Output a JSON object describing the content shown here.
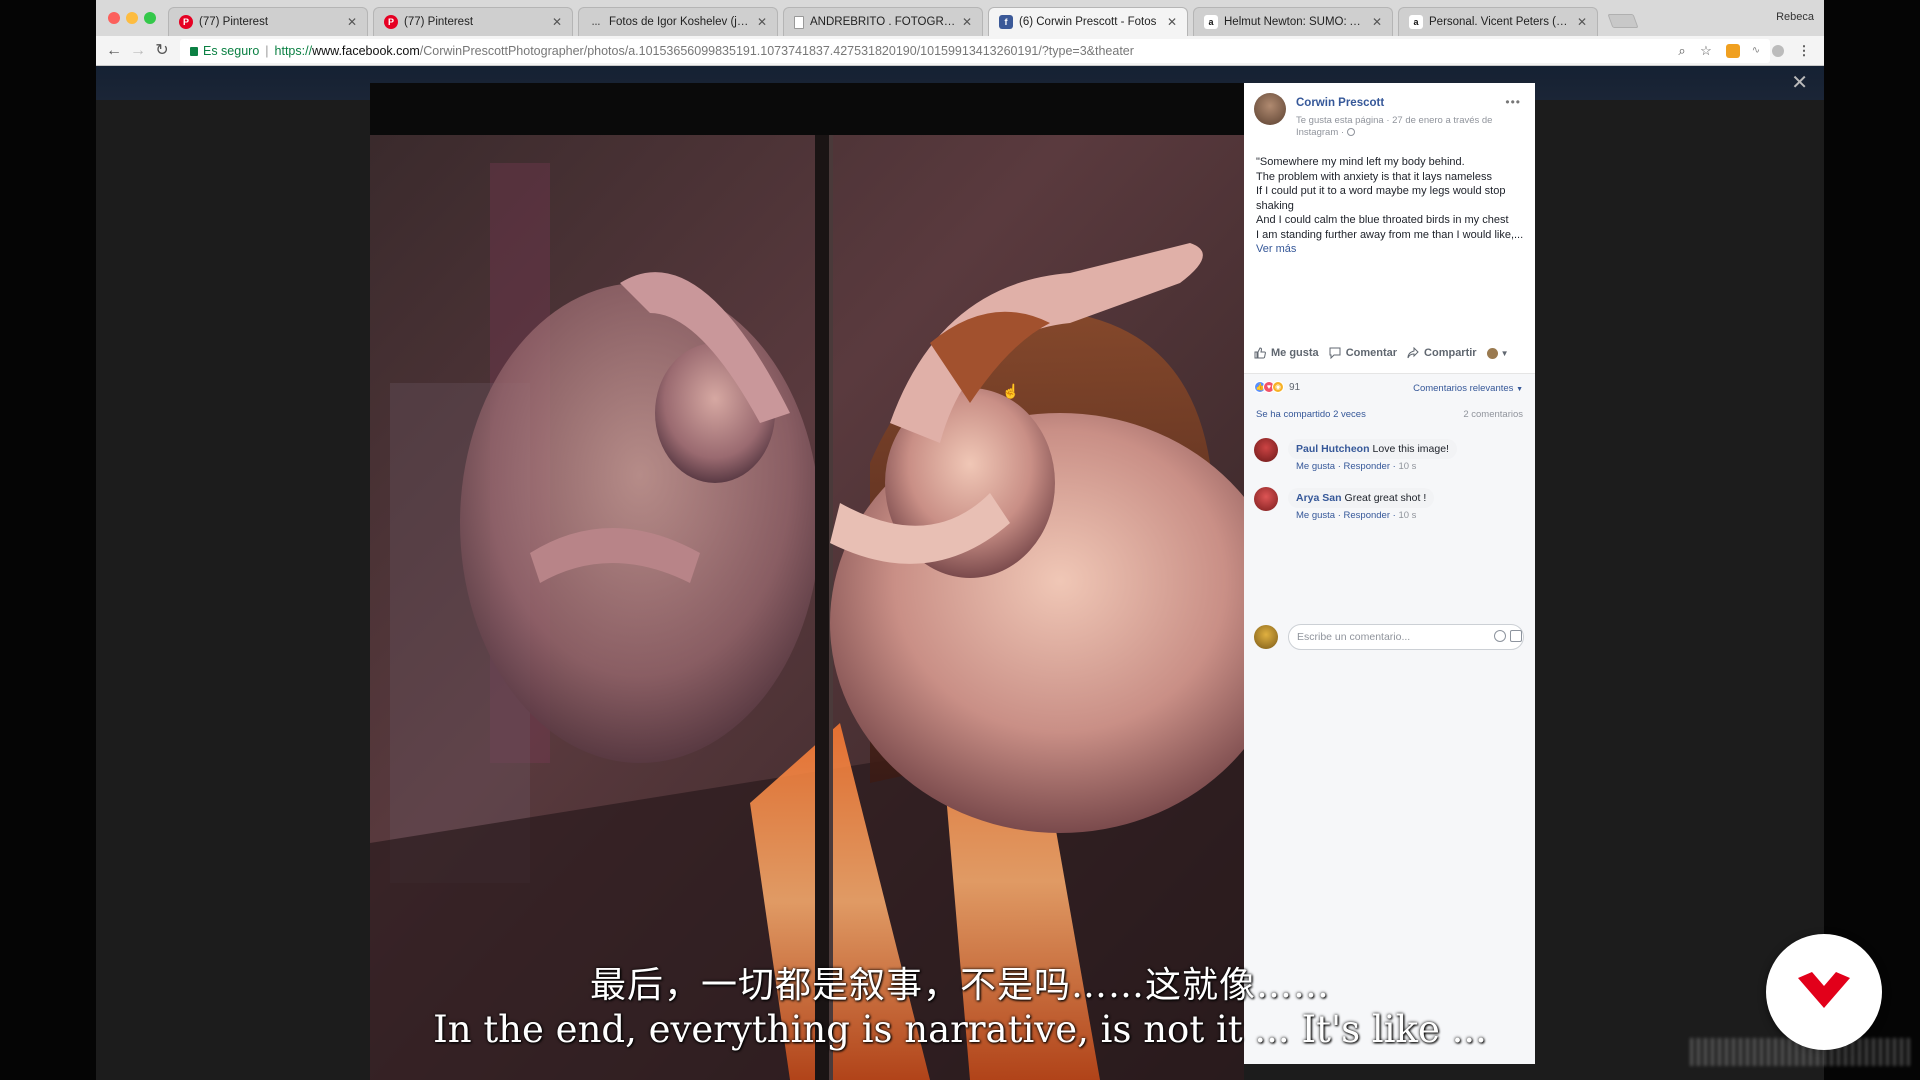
{
  "browser": {
    "user": "Rebeca",
    "tabs": [
      {
        "title": "(77) Pinterest",
        "favicon": "P",
        "color": "#e60023",
        "active": false
      },
      {
        "title": "(77) Pinterest",
        "favicon": "P",
        "color": "#e60023",
        "active": false
      },
      {
        "title": "Fotos de Igor Koshelev (jackvi",
        "favicon": "…",
        "color": "#555555",
        "active": false
      },
      {
        "title": "ANDRÉBRITO . FOTOGRAFIA",
        "favicon": "",
        "color": "#9a9a9a",
        "active": false
      },
      {
        "title": "(6) Corwin Prescott - Fotos",
        "favicon": "f",
        "color": "#3b5998",
        "active": true
      },
      {
        "title": "Helmut Newton: SUMO: Amaz",
        "favicon": "a",
        "color": "#111111",
        "active": false
      },
      {
        "title": "Personal. Vicent Peters (Photo",
        "favicon": "a",
        "color": "#111111",
        "active": false
      }
    ],
    "address": {
      "secure_label": "Es seguro",
      "scheme": "https://",
      "host": "www.facebook.com",
      "path": "/CorwinPrescottPhotographer/photos/a.10153656099835191.1073741837.427531820190/10159913413260191/?type=3&theater"
    }
  },
  "post": {
    "author": "Corwin Prescott",
    "meta": "Te gusta esta página · 27 de enero a través de Instagram · ",
    "text_lines": [
      "\"Somewhere my mind left my body behind.",
      "The problem with anxiety is that it lays nameless",
      "If I could put it to a word maybe my legs would stop shaking",
      "And I could calm the blue throated birds in my chest",
      "I am standing further away from me than I would like,..."
    ],
    "see_more": "Ver más",
    "actions": {
      "like": "Me gusta",
      "comment": "Comentar",
      "share": "Compartir"
    },
    "reaction_count": "91",
    "relevance": "Comentarios relevantes",
    "shared": "Se ha compartido 2 veces",
    "comment_count": "2 comentarios",
    "comments": [
      {
        "name": "Paul Hutcheon",
        "text": "Love this image!",
        "like": "Me gusta",
        "reply": "Responder",
        "time": "10 s"
      },
      {
        "name": "Arya San",
        "text": "Great great shot !",
        "like": "Me gusta",
        "reply": "Responder",
        "time": "10 s"
      }
    ],
    "comment_placeholder": "Escribe un comentario..."
  },
  "subtitles": {
    "zh": "最后，一切都是叙事，不是吗……这就像……",
    "en": "In the end, everything is narrative, is not it ... It's like ..."
  },
  "colors": {
    "fb_blue": "#365899",
    "logo_red": "#e2001a"
  }
}
